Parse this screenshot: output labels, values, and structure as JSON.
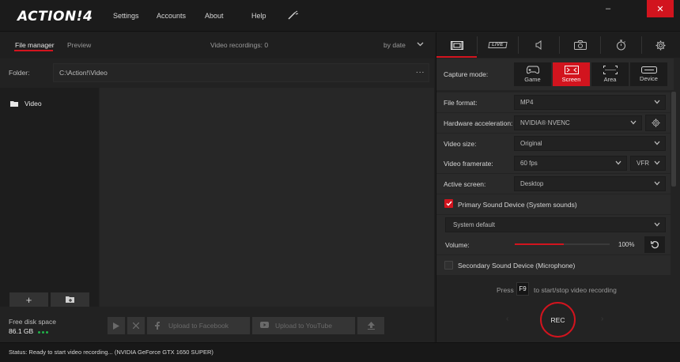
{
  "app": {
    "logo": "ACTION!",
    "logo_version": "4"
  },
  "menu": {
    "settings": "Settings",
    "accounts": "Accounts",
    "about": "About",
    "help": "Help",
    "tool_icon": "magic-wand-icon"
  },
  "window_controls": {
    "minimize": "–",
    "close": "✕"
  },
  "left": {
    "tabs": [
      {
        "label": "File manager",
        "active": true
      },
      {
        "label": "Preview",
        "active": false
      }
    ],
    "recordings_count": "Video recordings: 0",
    "sort_label": "by date",
    "folder_label": "Folder:",
    "folder_path": "C:\\Action!\\Video",
    "folder_more": "...",
    "tree": [
      {
        "label": "Video",
        "icon": "folder-icon"
      }
    ],
    "tree_buttons": {
      "add": "+",
      "open_folder_icon": "folder-open-icon"
    },
    "disk": {
      "label": "Free disk space",
      "value": "86.1 GB"
    },
    "actions": {
      "play_icon": "play-icon",
      "delete_icon": "close-icon",
      "upload_facebook": "Upload to Facebook",
      "upload_youtube": "Upload to YouTube",
      "upload_icon": "upload-icon"
    }
  },
  "status": {
    "text": "Status:   Ready to start video recording...  (NVIDIA GeForce GTX 1650 SUPER)"
  },
  "right": {
    "tabs": [
      {
        "name": "video-icon",
        "active": true
      },
      {
        "name": "live",
        "label": "LIVE",
        "active": false
      },
      {
        "name": "audio-icon",
        "active": false
      },
      {
        "name": "camera-icon",
        "active": false
      },
      {
        "name": "timer-icon",
        "active": false
      },
      {
        "name": "settings-icon",
        "active": false
      }
    ],
    "capture": {
      "label": "Capture mode:",
      "modes": [
        {
          "label": "Game",
          "icon": "gamepad-icon",
          "active": false
        },
        {
          "label": "Screen",
          "icon": "screen-icon",
          "active": true
        },
        {
          "label": "Area",
          "icon": "area-icon",
          "active": false
        },
        {
          "label": "Device",
          "icon": "device-icon",
          "active": false
        }
      ]
    },
    "settings": {
      "file_format": {
        "label": "File format:",
        "value": "MP4"
      },
      "hw_accel": {
        "label": "Hardware acceleration:",
        "value": "NVIDIA® NVENC"
      },
      "video_size": {
        "label": "Video size:",
        "value": "Original"
      },
      "framerate": {
        "label": "Video framerate:",
        "value": "60 fps",
        "mode": "VFR"
      },
      "active_screen": {
        "label": "Active screen:",
        "value": "Desktop"
      }
    },
    "primary_sound": {
      "label": "Primary Sound Device (System sounds)",
      "checked": true,
      "device": "System default"
    },
    "volume": {
      "label": "Volume:",
      "value": "100%",
      "level": 0.52
    },
    "secondary_sound": {
      "label": "Secondary Sound Device (Microphone)",
      "checked": false
    },
    "hint": {
      "pre": "Press",
      "key": "F9",
      "post": "to start/stop video recording"
    },
    "rec_label": "REC"
  },
  "colors": {
    "accent": "#d2141e",
    "bg": "#1e1e1e",
    "disk_ok": "#21b24a"
  }
}
